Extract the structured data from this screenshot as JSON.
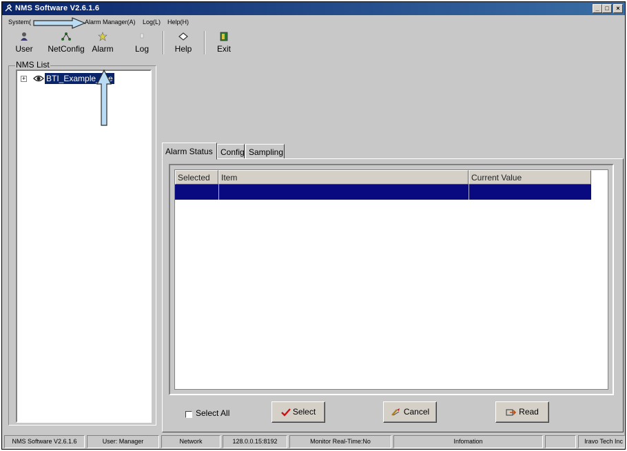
{
  "window": {
    "title": "NMS Software V2.6.1.6",
    "controls": [
      "minimize",
      "maximize",
      "close"
    ]
  },
  "menubar": {
    "items": [
      {
        "label": "System(S)",
        "visible_label": "System("
      },
      {
        "label": "Alarm Manager(A)"
      },
      {
        "label": "Log(L)"
      },
      {
        "label": "Help(H)"
      }
    ]
  },
  "toolbar": {
    "buttons": [
      {
        "label": "User",
        "icon": "user-icon"
      },
      {
        "label": "NetConfig",
        "icon": "network-icon"
      },
      {
        "label": "Alarm",
        "icon": "alarm-icon"
      },
      {
        "label": "Log",
        "icon": "log-icon"
      },
      {
        "label": "Help",
        "icon": "help-icon"
      },
      {
        "label": "Exit",
        "icon": "exit-icon"
      }
    ]
  },
  "nms_list": {
    "legend": "NMS List",
    "tree": [
      {
        "label": "BTI_Example_Site",
        "visible_label": "BTI_Example_S  e",
        "expanded": false,
        "selected": true
      }
    ]
  },
  "tabs": [
    {
      "label": "Alarm Status",
      "active": true
    },
    {
      "label": "Config",
      "active": false
    },
    {
      "label": "Sampling",
      "active": false
    }
  ],
  "grid": {
    "columns": [
      "Selected",
      "Item",
      "Current Value"
    ],
    "rows": [
      {
        "selected": "",
        "item": "",
        "current_value": "",
        "highlighted": true
      }
    ]
  },
  "actions": {
    "select_all_label": "Select All",
    "select_all_checked": false,
    "select_label": "Select",
    "cancel_label": "Cancel",
    "read_label": "Read"
  },
  "statusbar": {
    "cells": [
      "NMS Software V2.6.1.6",
      "User: Manager",
      "Network",
      "128.0.0.15:8192",
      "Monitor Real-Time:No",
      "Infomation",
      "",
      "Iravo Tech Inc"
    ]
  },
  "colors": {
    "titlebar": "#0a246a",
    "selection": "#0a0a80",
    "face": "#c8c8c8",
    "annotation_arrow": "#b9dcf4"
  }
}
